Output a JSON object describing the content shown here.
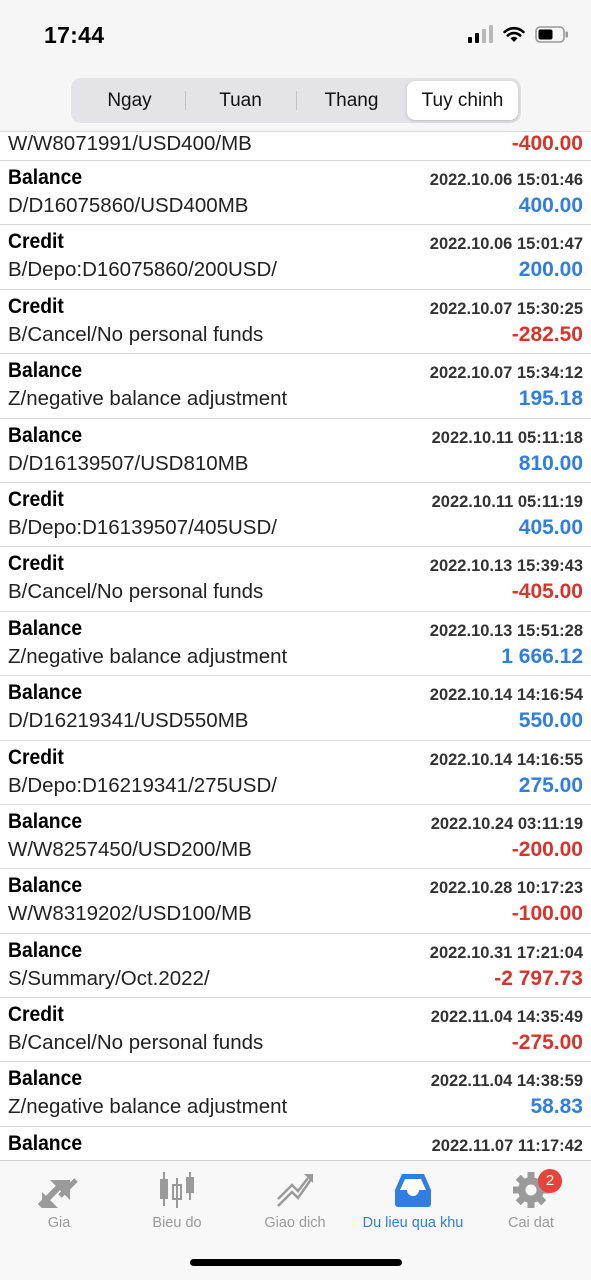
{
  "status": {
    "time": "17:44"
  },
  "segments": [
    "Ngay",
    "Tuan",
    "Thang",
    "Tuy chinh"
  ],
  "first_row": {
    "comment": "W/W8071991/USD400/MB",
    "amount": "-400.00"
  },
  "rows": [
    {
      "type": "Balance",
      "date": "2022.10.06 15:01:46",
      "comment": "D/D16075860/USD400MB",
      "amount": "400.00"
    },
    {
      "type": "Credit",
      "date": "2022.10.06 15:01:47",
      "comment": "B/Depo:D16075860/200USD/",
      "amount": "200.00"
    },
    {
      "type": "Credit",
      "date": "2022.10.07 15:30:25",
      "comment": "B/Cancel/No personal funds",
      "amount": "-282.50"
    },
    {
      "type": "Balance",
      "date": "2022.10.07 15:34:12",
      "comment": "Z/negative balance adjustment",
      "amount": "195.18"
    },
    {
      "type": "Balance",
      "date": "2022.10.11 05:11:18",
      "comment": "D/D16139507/USD810MB",
      "amount": "810.00"
    },
    {
      "type": "Credit",
      "date": "2022.10.11 05:11:19",
      "comment": "B/Depo:D16139507/405USD/",
      "amount": "405.00"
    },
    {
      "type": "Credit",
      "date": "2022.10.13 15:39:43",
      "comment": "B/Cancel/No personal funds",
      "amount": "-405.00"
    },
    {
      "type": "Balance",
      "date": "2022.10.13 15:51:28",
      "comment": "Z/negative balance adjustment",
      "amount": "1 666.12"
    },
    {
      "type": "Balance",
      "date": "2022.10.14 14:16:54",
      "comment": "D/D16219341/USD550MB",
      "amount": "550.00"
    },
    {
      "type": "Credit",
      "date": "2022.10.14 14:16:55",
      "comment": "B/Depo:D16219341/275USD/",
      "amount": "275.00"
    },
    {
      "type": "Balance",
      "date": "2022.10.24 03:11:19",
      "comment": "W/W8257450/USD200/MB",
      "amount": "-200.00"
    },
    {
      "type": "Balance",
      "date": "2022.10.28 10:17:23",
      "comment": "W/W8319202/USD100/MB",
      "amount": "-100.00"
    },
    {
      "type": "Balance",
      "date": "2022.10.31 17:21:04",
      "comment": "S/Summary/Oct.2022/",
      "amount": "-2 797.73"
    },
    {
      "type": "Credit",
      "date": "2022.11.04 14:35:49",
      "comment": "B/Cancel/No personal funds",
      "amount": "-275.00"
    },
    {
      "type": "Balance",
      "date": "2022.11.04 14:38:59",
      "comment": "Z/negative balance adjustment",
      "amount": "58.83"
    }
  ],
  "last_row": {
    "type": "Balance",
    "date": "2022.11.07 11:17:42"
  },
  "tabs": [
    {
      "label": "Gia",
      "icon": "arrows-icon"
    },
    {
      "label": "Bieu do",
      "icon": "candlestick-icon"
    },
    {
      "label": "Giao dich",
      "icon": "trend-icon"
    },
    {
      "label": "Du lieu qua khu",
      "icon": "inbox-icon"
    },
    {
      "label": "Cai dat",
      "icon": "gear-icon",
      "badge": "2"
    }
  ],
  "colors": {
    "negative": "#d9342b",
    "positive": "#2f7ee0",
    "active_tab": "#2f7ee0"
  }
}
